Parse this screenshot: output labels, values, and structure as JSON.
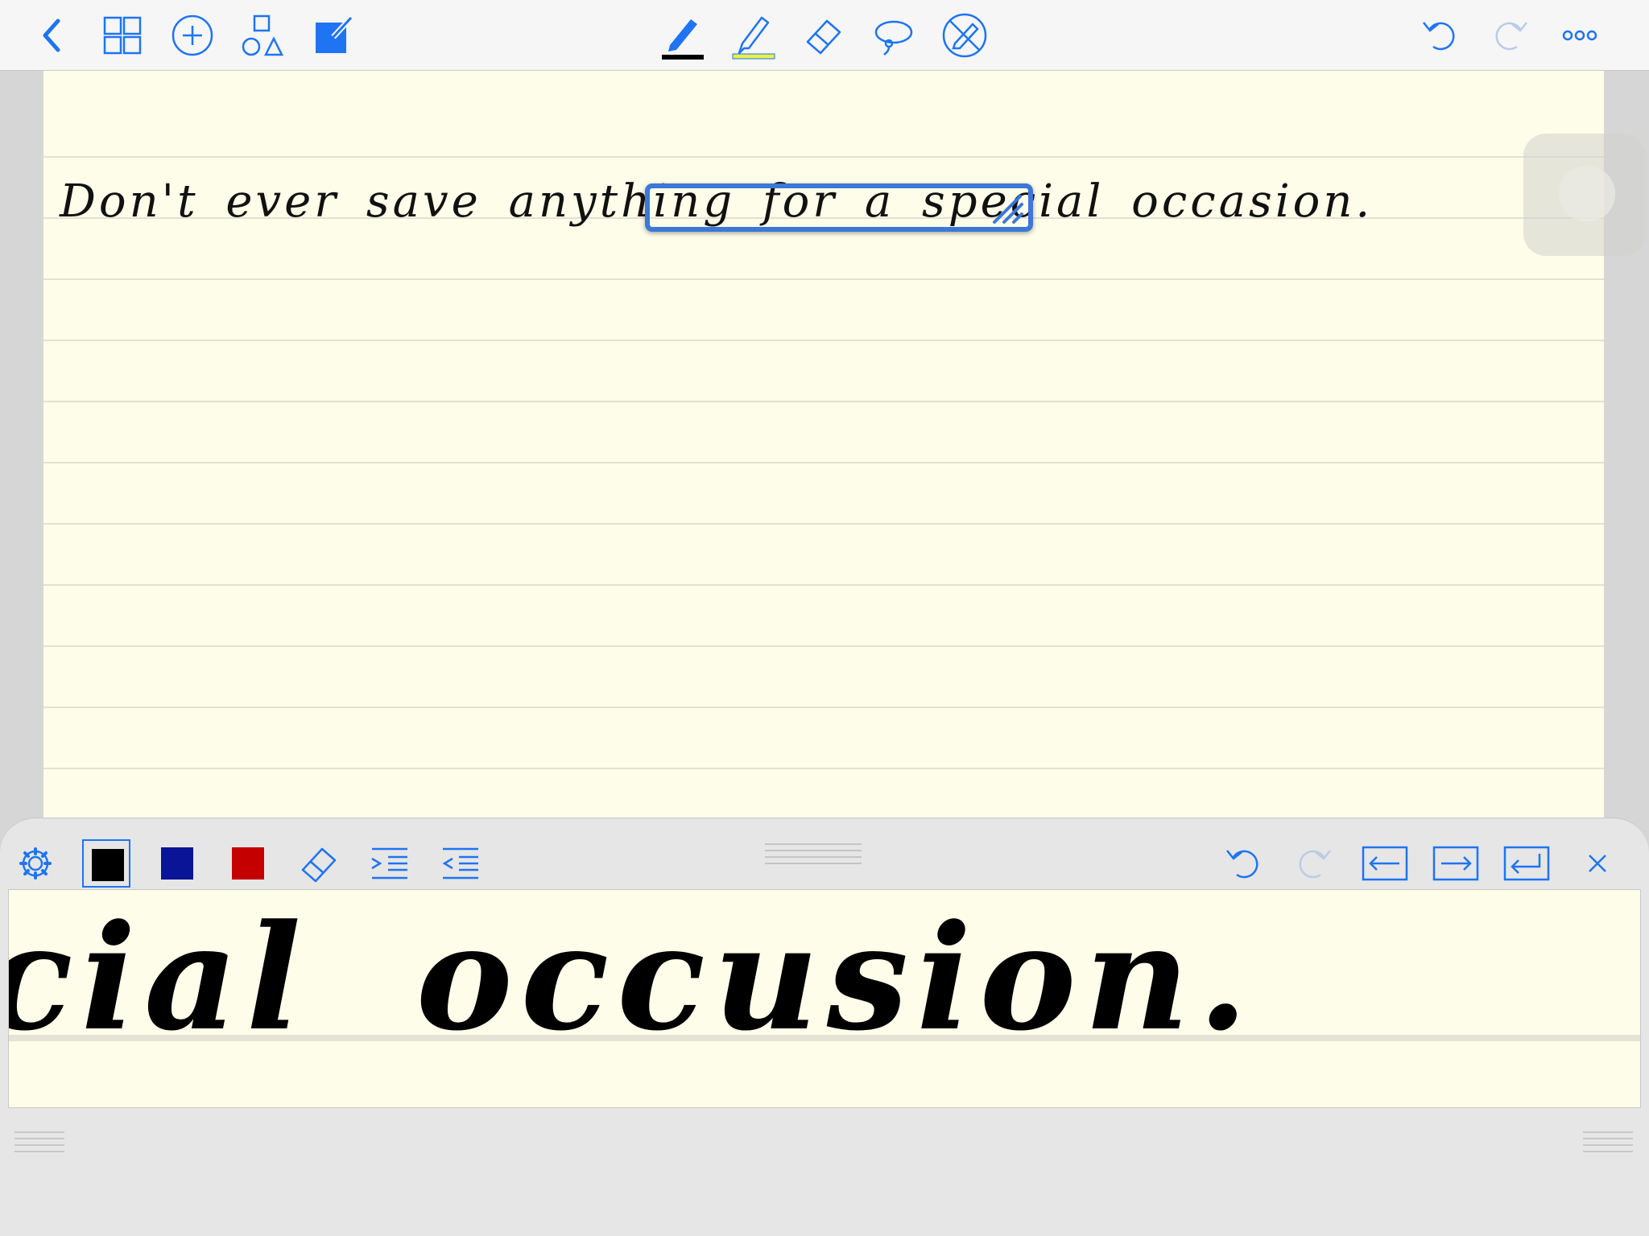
{
  "toolbar": {
    "left": [
      "back",
      "pages",
      "add",
      "shapes",
      "edit"
    ],
    "tools": [
      "pen",
      "highlighter",
      "eraser",
      "lasso",
      "disable-pen"
    ],
    "right": [
      "undo",
      "redo",
      "more"
    ]
  },
  "colors": {
    "accent": "#1e74f2",
    "pen_underline": "#000000",
    "highlighter_underline": "#e8f04a",
    "paper": "#fdfde9"
  },
  "page": {
    "handwriting_text": "Don't ever save anything for a special occasion."
  },
  "panel": {
    "colors": [
      {
        "name": "black",
        "hex": "#000000",
        "selected": true
      },
      {
        "name": "dark-blue",
        "hex": "#0a1496",
        "selected": false
      },
      {
        "name": "red",
        "hex": "#c40000",
        "selected": false
      }
    ],
    "tools": [
      "settings",
      "eraser",
      "indent",
      "outdent",
      "undo",
      "redo",
      "move-left",
      "move-right",
      "new-line",
      "close"
    ],
    "zoomed_text": "cial occusion."
  }
}
